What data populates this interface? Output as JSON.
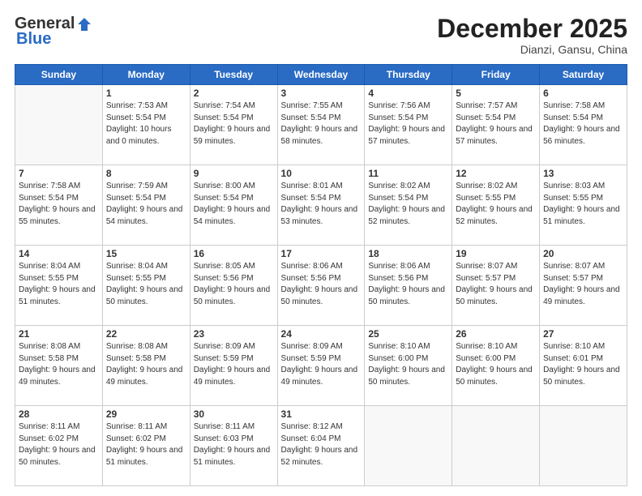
{
  "logo": {
    "general": "General",
    "blue": "Blue"
  },
  "header": {
    "month": "December 2025",
    "location": "Dianzi, Gansu, China"
  },
  "days_of_week": [
    "Sunday",
    "Monday",
    "Tuesday",
    "Wednesday",
    "Thursday",
    "Friday",
    "Saturday"
  ],
  "weeks": [
    [
      {
        "day": "",
        "empty": true
      },
      {
        "day": "1",
        "sunrise": "7:53 AM",
        "sunset": "5:54 PM",
        "daylight": "10 hours and 0 minutes."
      },
      {
        "day": "2",
        "sunrise": "7:54 AM",
        "sunset": "5:54 PM",
        "daylight": "9 hours and 59 minutes."
      },
      {
        "day": "3",
        "sunrise": "7:55 AM",
        "sunset": "5:54 PM",
        "daylight": "9 hours and 58 minutes."
      },
      {
        "day": "4",
        "sunrise": "7:56 AM",
        "sunset": "5:54 PM",
        "daylight": "9 hours and 57 minutes."
      },
      {
        "day": "5",
        "sunrise": "7:57 AM",
        "sunset": "5:54 PM",
        "daylight": "9 hours and 57 minutes."
      },
      {
        "day": "6",
        "sunrise": "7:58 AM",
        "sunset": "5:54 PM",
        "daylight": "9 hours and 56 minutes."
      }
    ],
    [
      {
        "day": "7",
        "sunrise": "7:58 AM",
        "sunset": "5:54 PM",
        "daylight": "9 hours and 55 minutes."
      },
      {
        "day": "8",
        "sunrise": "7:59 AM",
        "sunset": "5:54 PM",
        "daylight": "9 hours and 54 minutes."
      },
      {
        "day": "9",
        "sunrise": "8:00 AM",
        "sunset": "5:54 PM",
        "daylight": "9 hours and 54 minutes."
      },
      {
        "day": "10",
        "sunrise": "8:01 AM",
        "sunset": "5:54 PM",
        "daylight": "9 hours and 53 minutes."
      },
      {
        "day": "11",
        "sunrise": "8:02 AM",
        "sunset": "5:54 PM",
        "daylight": "9 hours and 52 minutes."
      },
      {
        "day": "12",
        "sunrise": "8:02 AM",
        "sunset": "5:55 PM",
        "daylight": "9 hours and 52 minutes."
      },
      {
        "day": "13",
        "sunrise": "8:03 AM",
        "sunset": "5:55 PM",
        "daylight": "9 hours and 51 minutes."
      }
    ],
    [
      {
        "day": "14",
        "sunrise": "8:04 AM",
        "sunset": "5:55 PM",
        "daylight": "9 hours and 51 minutes."
      },
      {
        "day": "15",
        "sunrise": "8:04 AM",
        "sunset": "5:55 PM",
        "daylight": "9 hours and 50 minutes."
      },
      {
        "day": "16",
        "sunrise": "8:05 AM",
        "sunset": "5:56 PM",
        "daylight": "9 hours and 50 minutes."
      },
      {
        "day": "17",
        "sunrise": "8:06 AM",
        "sunset": "5:56 PM",
        "daylight": "9 hours and 50 minutes."
      },
      {
        "day": "18",
        "sunrise": "8:06 AM",
        "sunset": "5:56 PM",
        "daylight": "9 hours and 50 minutes."
      },
      {
        "day": "19",
        "sunrise": "8:07 AM",
        "sunset": "5:57 PM",
        "daylight": "9 hours and 50 minutes."
      },
      {
        "day": "20",
        "sunrise": "8:07 AM",
        "sunset": "5:57 PM",
        "daylight": "9 hours and 49 minutes."
      }
    ],
    [
      {
        "day": "21",
        "sunrise": "8:08 AM",
        "sunset": "5:58 PM",
        "daylight": "9 hours and 49 minutes."
      },
      {
        "day": "22",
        "sunrise": "8:08 AM",
        "sunset": "5:58 PM",
        "daylight": "9 hours and 49 minutes."
      },
      {
        "day": "23",
        "sunrise": "8:09 AM",
        "sunset": "5:59 PM",
        "daylight": "9 hours and 49 minutes."
      },
      {
        "day": "24",
        "sunrise": "8:09 AM",
        "sunset": "5:59 PM",
        "daylight": "9 hours and 49 minutes."
      },
      {
        "day": "25",
        "sunrise": "8:10 AM",
        "sunset": "6:00 PM",
        "daylight": "9 hours and 50 minutes."
      },
      {
        "day": "26",
        "sunrise": "8:10 AM",
        "sunset": "6:00 PM",
        "daylight": "9 hours and 50 minutes."
      },
      {
        "day": "27",
        "sunrise": "8:10 AM",
        "sunset": "6:01 PM",
        "daylight": "9 hours and 50 minutes."
      }
    ],
    [
      {
        "day": "28",
        "sunrise": "8:11 AM",
        "sunset": "6:02 PM",
        "daylight": "9 hours and 50 minutes."
      },
      {
        "day": "29",
        "sunrise": "8:11 AM",
        "sunset": "6:02 PM",
        "daylight": "9 hours and 51 minutes."
      },
      {
        "day": "30",
        "sunrise": "8:11 AM",
        "sunset": "6:03 PM",
        "daylight": "9 hours and 51 minutes."
      },
      {
        "day": "31",
        "sunrise": "8:12 AM",
        "sunset": "6:04 PM",
        "daylight": "9 hours and 52 minutes."
      },
      {
        "day": "",
        "empty": true
      },
      {
        "day": "",
        "empty": true
      },
      {
        "day": "",
        "empty": true
      }
    ]
  ]
}
